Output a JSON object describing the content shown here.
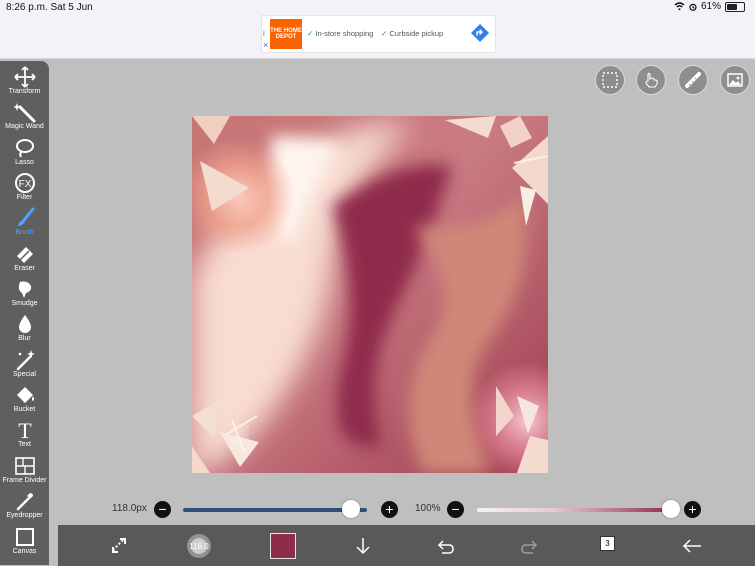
{
  "status_bar": {
    "time": "8:26 p.m.",
    "date": "Sat 5 Jun",
    "battery": "61%",
    "battery_level": 0.61
  },
  "ad": {
    "brand": "THE HOME DEPOT",
    "feature_1": "In-store shopping",
    "feature_2": "Curbside pickup",
    "info_icon": "i"
  },
  "left_tools": [
    {
      "name": "Transform",
      "icon": "move-icon"
    },
    {
      "name": "Magic Wand",
      "icon": "magic-wand-icon"
    },
    {
      "name": "Lasso",
      "icon": "lasso-icon"
    },
    {
      "name": "Filter",
      "icon": "fx-icon"
    },
    {
      "name": "Brush",
      "icon": "brush-icon",
      "active": true
    },
    {
      "name": "Eraser",
      "icon": "eraser-icon"
    },
    {
      "name": "Smudge",
      "icon": "smudge-icon"
    },
    {
      "name": "Blur",
      "icon": "drop-icon"
    },
    {
      "name": "Special",
      "icon": "special-icon"
    },
    {
      "name": "Bucket",
      "icon": "bucket-icon"
    },
    {
      "name": "Text",
      "icon": "text-icon"
    },
    {
      "name": "Frame Divider",
      "icon": "frame-divider-icon"
    },
    {
      "name": "Eyedropper",
      "icon": "eyedropper-icon"
    },
    {
      "name": "Canvas",
      "icon": "canvas-icon"
    }
  ],
  "brush_controls": {
    "size_label": "118.0px",
    "size_value": 118.0,
    "size_fraction": 0.915,
    "opacity_label": "100%",
    "opacity_value": 100,
    "opacity_fraction": 1.0
  },
  "bottom_bar": {
    "brush_size_preview": "118.0",
    "layer_count": "3"
  },
  "colors": {
    "accent": "#4aa3ff",
    "toolbar": "#5f5f5f",
    "bottom_toolbar": "#595959",
    "canvas_bg": "#bfbfbf",
    "current_color": "#8d2d49"
  }
}
